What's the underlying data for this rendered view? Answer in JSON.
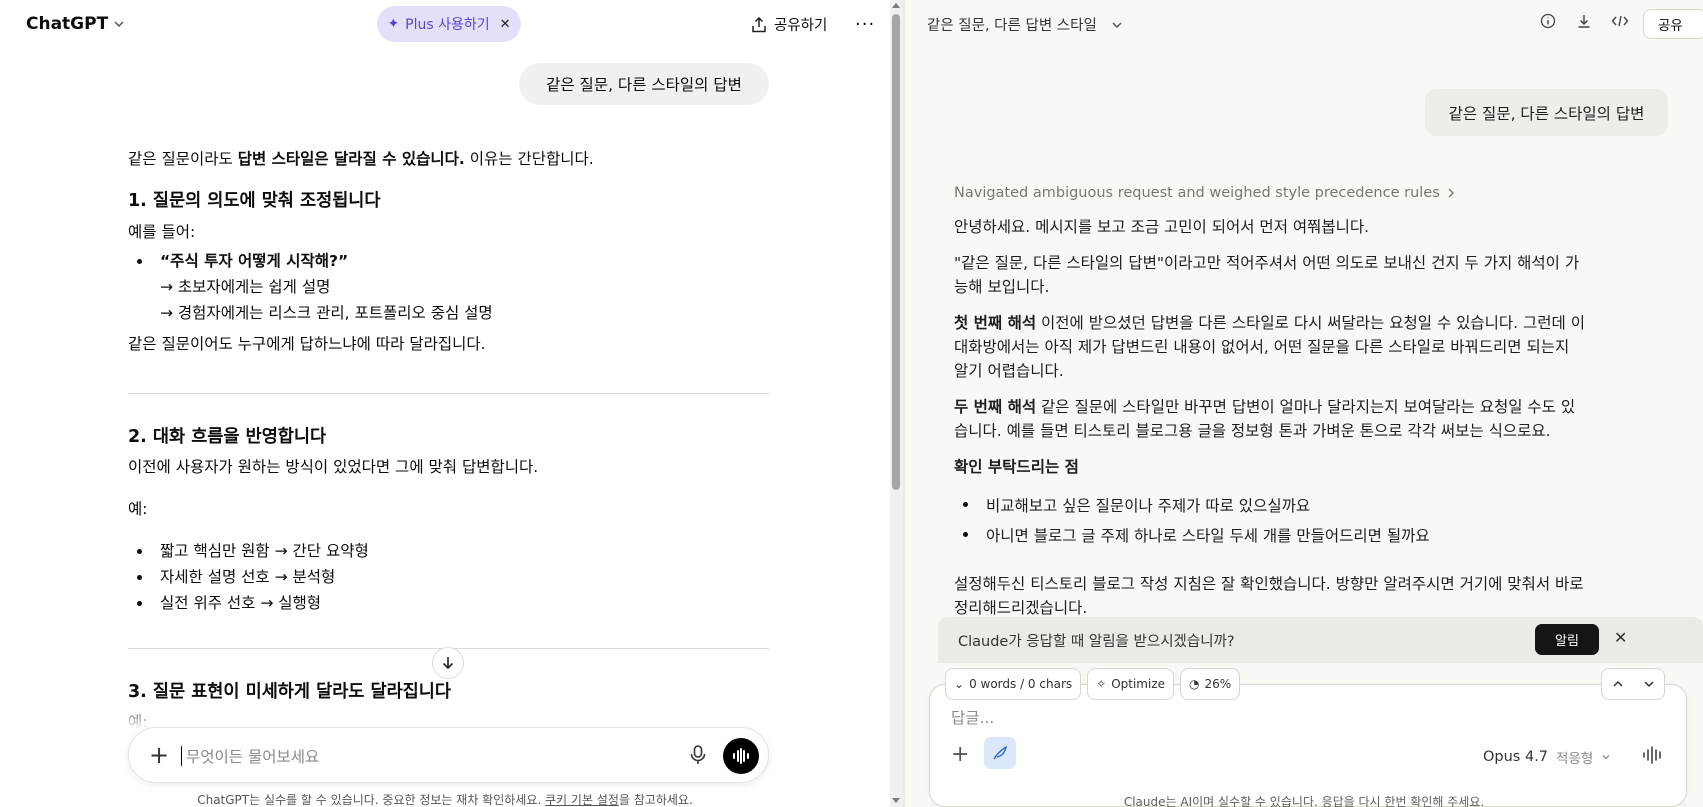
{
  "left": {
    "app_title": "ChatGPT",
    "plus_pill": "Plus 사용하기",
    "share": "공유하기",
    "user_message": "같은 질문, 다른 스타일의 답변",
    "intro": {
      "pre": "같은 질문이라도 ",
      "bold": "답변 스타일은 달라질 수 있습니다.",
      "post": " 이유는 간단합니다."
    },
    "section1": {
      "title": "1. 질문의 의도에 맞춰 조정됩니다",
      "lead": "예를 들어:",
      "bullet_bold": "“주식 투자 어떻게 시작해?”",
      "sub1": "→ 초보자에게는 쉽게 설명",
      "sub2": "→ 경험자에게는 리스크 관리, 포트폴리오 중심 설명",
      "conclusion": "같은 질문이어도 누구에게 답하느냐에 따라 달라집니다."
    },
    "section2": {
      "title": "2. 대화 흐름을 반영합니다",
      "text": "이전에 사용자가 원하는 방식이 있었다면 그에 맞춰 답변합니다.",
      "lead": "예:",
      "items": [
        "짧고 핵심만 원함 → 간단 요약형",
        "자세한 설명 선호 → 분석형",
        "실전 위주 선호 → 실행형"
      ]
    },
    "section3": {
      "title": "3. 질문 표현이 미세하게 달라도 달라집니다",
      "lead": "예:"
    },
    "composer_placeholder": "무엇이든 물어보세요",
    "disclaimer_pre": "ChatGPT는 실수를 할 수 있습니다. 중요한 정보는 재차 확인하세요. ",
    "disclaimer_link": "쿠키 기본 설정",
    "disclaimer_post": "을 참고하세요."
  },
  "right": {
    "chat_title": "같은 질문, 다른 답변 스타일",
    "share": "공유",
    "user_message": "같은 질문, 다른 스타일의 답변",
    "thinking": "Navigated ambiguous request and weighed style precedence rules",
    "p1": "안녕하세요. 메시지를 보고 조금 고민이 되어서 먼저 여쭤봅니다.",
    "p2a": "\"같은 질문, 다른 스타일의 답변\"이라고만 적어주셔서 어떤 의도로 보내신 건지 두 가지 해석이 가",
    "p2b": "능해 보입니다.",
    "p3_bold": "첫 번째 해석",
    "p3a": " 이전에 받으셨던 답변을 다른 스타일로 다시 써달라는 요청일 수 있습니다. 그런데 이",
    "p3b": "대화방에서는 아직 제가 답변드린 내용이 없어서, 어떤 질문을 다른 스타일로 바꿔드리면 되는지",
    "p3c": "알기 어렵습니다.",
    "p4_bold": "두 번째 해석",
    "p4a": " 같은 질문에 스타일만 바꾸면 답변이 얼마나 달라지는지 보여달라는 요청일 수도 있",
    "p4b": "습니다. 예를 들면 티스토리 블로그용 글을 정보형 톤과 가벼운 톤으로 각각 써보는 식으로요.",
    "confirm_title": "확인 부탁드리는 점",
    "confirm_items": [
      "비교해보고 싶은 질문이나 주제가 따로 있으실까요",
      "아니면 블로그 글 주제 하나로 스타일 두세 개를 만들어드리면 될까요"
    ],
    "p5a": "설정해두신 티스토리 블로그 작성 지침은 잘 확인했습니다. 방향만 알려주시면 거기에 맞춰서 바로",
    "p5b": "정리해드리겠습니다.",
    "notif_text": "Claude가 응답할 때 알림을 받으시겠습니까?",
    "notif_button": "알림",
    "chip_words": "0 words / 0 chars",
    "chip_optimize": "Optimize",
    "chip_percent": "26%",
    "composer_placeholder": "답글...",
    "model": "Opus 4.7",
    "model_mode": "적응형",
    "disclaimer": "Claude는 AI이며 실수할 수 있습니다. 응답을 다시 한번 확인해 주세요."
  }
}
